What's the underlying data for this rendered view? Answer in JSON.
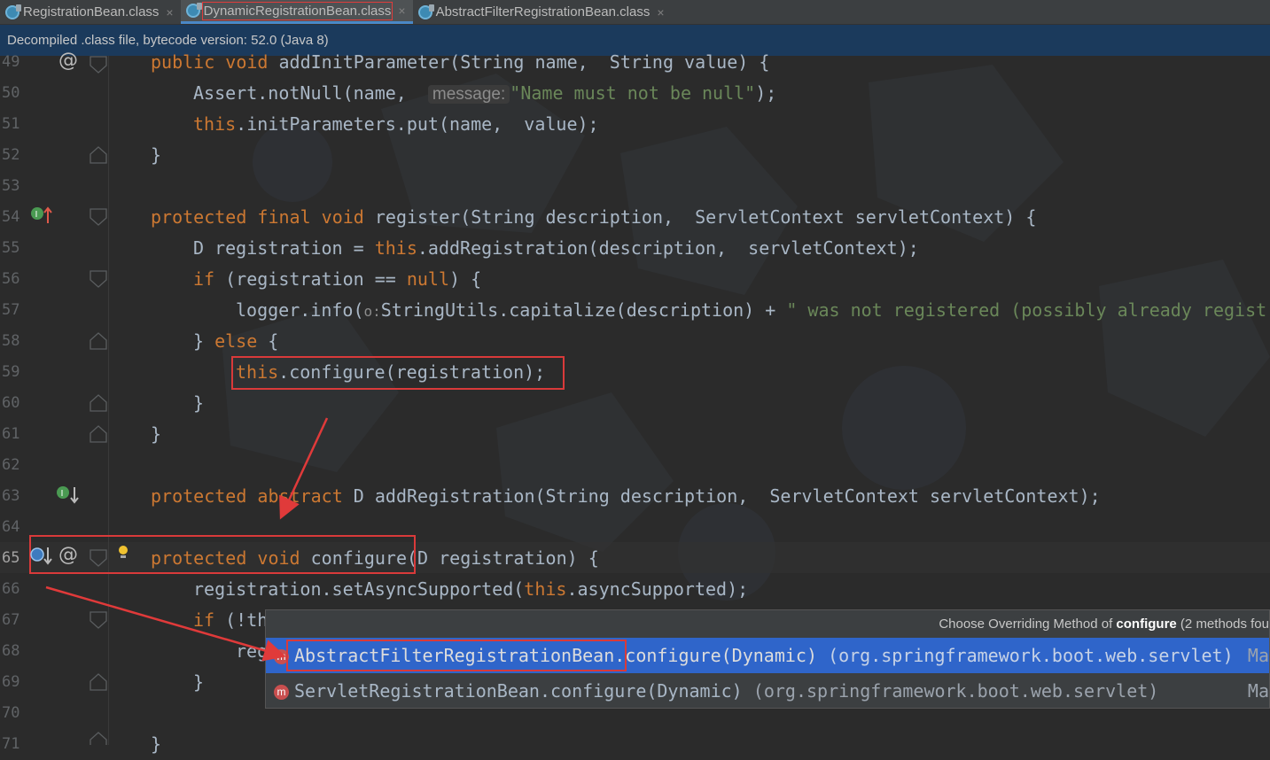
{
  "tabs": [
    {
      "label": "RegistrationBean.class",
      "close": "×"
    },
    {
      "label": "DynamicRegistrationBean.class",
      "close": "×"
    },
    {
      "label": "AbstractFilterRegistrationBean.class",
      "close": "×"
    }
  ],
  "banner": {
    "text": "Decompiled .class file, bytecode version: 52.0 (Java 8)"
  },
  "gutter": {
    "line_numbers": [
      "49",
      "50",
      "51",
      "52",
      "53",
      "54",
      "55",
      "56",
      "57",
      "58",
      "59",
      "60",
      "61",
      "62",
      "63",
      "64",
      "65",
      "66",
      "67",
      "68",
      "69",
      "70",
      "71"
    ],
    "current_line": "65"
  },
  "code": {
    "l49": {
      "kw1": "public void ",
      "rest": "addInitParameter(String name,  String value) {"
    },
    "l50": {
      "a": "Assert.notNull(name,  ",
      "hint": "message:",
      "str": "\"Name must not be null\"",
      "b": ");"
    },
    "l51": {
      "kw": "this",
      "rest": ".initParameters.put(name,  value);"
    },
    "l52": {
      "text": "}"
    },
    "l54": {
      "kw": "protected final void ",
      "rest": "register(String description,  ServletContext servletContext) {"
    },
    "l55": {
      "a": "D registration = ",
      "kw": "this",
      "b": ".addRegistration(description,  servletContext);"
    },
    "l56": {
      "kw": "if ",
      "a": "(registration == ",
      "kw2": "null",
      "b": ") {"
    },
    "l57": {
      "a": "logger.info(",
      "hint": "o:",
      "b": "StringUtils.capitalize(description) + ",
      "str": "\" was not registered (possibly already regist"
    },
    "l58": {
      "a": "} ",
      "kw": "else",
      "b": " {"
    },
    "l59": {
      "kw": "this",
      "rest": ".configure(registration);"
    },
    "l60": {
      "text": "}"
    },
    "l61": {
      "text": "}"
    },
    "l63": {
      "kw": "protected abstract ",
      "rest": "D addRegistration(String description,  ServletContext servletContext);"
    },
    "l65": {
      "kw": "protected void ",
      "rest": "configure(D registration) {"
    },
    "l66": {
      "a": "registration.setAsyncSupported(",
      "kw": "this",
      "b": ".asyncSupported);"
    },
    "l67": {
      "kw": "if ",
      "rest": "(!th"
    },
    "l68": {
      "rest": "reg"
    },
    "l69": {
      "text": "}"
    },
    "l71": {
      "text": "}"
    }
  },
  "popup": {
    "title_prefix": "Choose Overriding Method of ",
    "title_method": "configure",
    "title_suffix": " (2 methods fou",
    "rows": [
      {
        "icon": "m",
        "name": "AbstractFilterRegistrationBean.configure(Dynamic)",
        "pkg": "(org.springframework.boot.web.servlet)",
        "mod": "Ma"
      },
      {
        "icon": "m",
        "name": "ServletRegistrationBean.configure(Dynamic)",
        "pkg": "(org.springframework.boot.web.servlet)",
        "mod": "Ma"
      }
    ]
  },
  "colors": {
    "keyword": "#cc7832",
    "string": "#6a8759",
    "annotation": "#d93a3a",
    "selection": "#2f65ca"
  }
}
